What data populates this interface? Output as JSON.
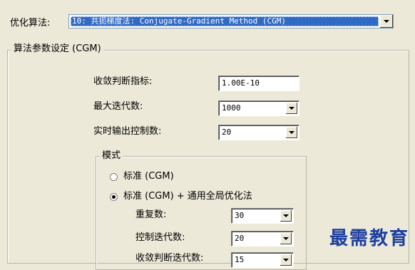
{
  "algorithm": {
    "label": "优化算法:",
    "selected": "10: 共扼梯度法: Conjugate-Gradient Method (CGM)"
  },
  "params_group": {
    "title": "算法参数设定 (CGM)",
    "convergence": {
      "label": "收敛判断指标:",
      "value": "1.00E-10"
    },
    "max_iter": {
      "label": "最大迭代数:",
      "value": "1000"
    },
    "realtime_output": {
      "label": "实时输出控制数:",
      "value": "20"
    }
  },
  "mode_group": {
    "title": "模式",
    "option_standard": "标准 (CGM)",
    "option_standard_global": "标准 (CGM) + 通用全局优化法",
    "selected_option": "standard_global",
    "repeat": {
      "label": "重复数:",
      "value": "30"
    },
    "control_iter": {
      "label": "控制迭代数:",
      "value": "20"
    },
    "stop_iter": {
      "label": "收敛判断迭代数:",
      "value": "15"
    }
  },
  "watermark": "最需教育"
}
